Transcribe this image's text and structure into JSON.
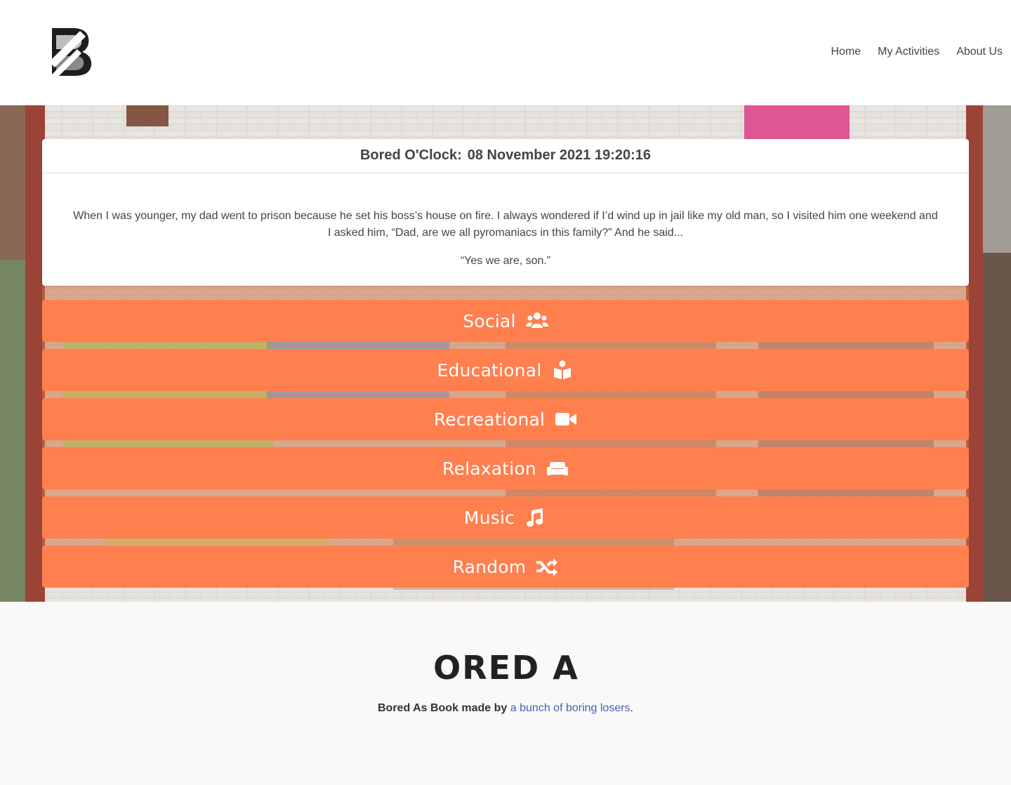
{
  "header": {
    "logo_alt": "B",
    "nav": [
      {
        "label": "Home"
      },
      {
        "label": "My Activities"
      },
      {
        "label": "About Us"
      }
    ]
  },
  "card": {
    "clock_label": "Bored O'Clock:",
    "clock_value": "08 November 2021 19:20:16",
    "joke_setup": "When I was younger, my dad went to prison because he set his boss’s house on fire. I always wondered if I’d wind up in jail like my old man, so I visited him one weekend and I asked him, “Dad, are we all pyromaniacs in this family?” And he said...",
    "joke_punchline": "“Yes we are, son.”"
  },
  "buttons": [
    {
      "label": "Social",
      "icon": "users-icon"
    },
    {
      "label": "Educational",
      "icon": "book-reader-icon"
    },
    {
      "label": "Recreational",
      "icon": "video-icon"
    },
    {
      "label": "Relaxation",
      "icon": "couch-icon"
    },
    {
      "label": "Music",
      "icon": "music-icon"
    },
    {
      "label": "Random",
      "icon": "random-icon"
    }
  ],
  "footer": {
    "brand": "BORED AS",
    "made_by": "Bored As Book made by",
    "link_text": "a bunch of boring losers",
    "period": "."
  },
  "colors": {
    "accent": "#ff7f4f",
    "link": "#4a5fb0"
  }
}
